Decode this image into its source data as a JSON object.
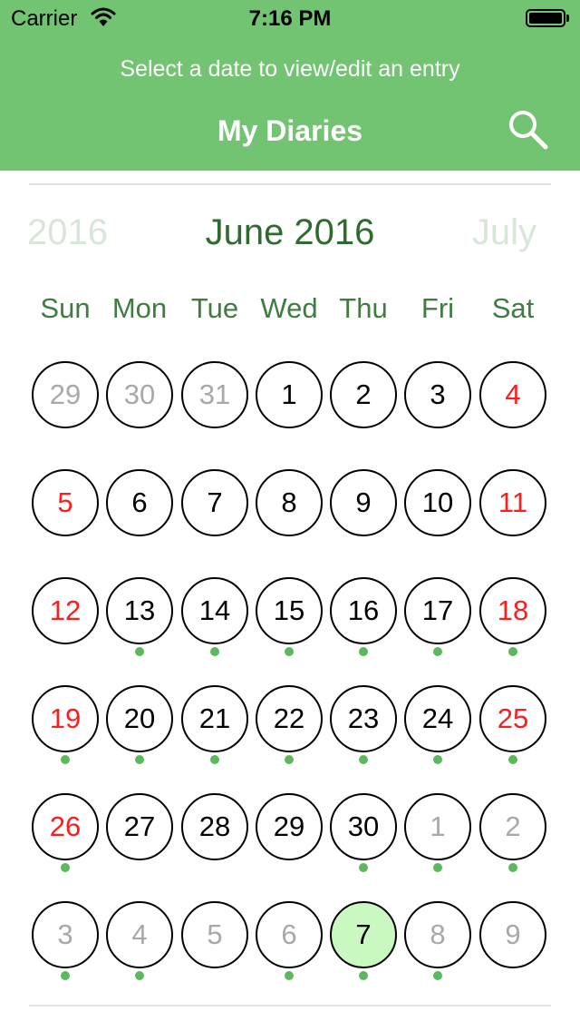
{
  "status_bar": {
    "carrier": "Carrier",
    "time": "7:16 PM"
  },
  "header": {
    "subtitle": "Select a date to view/edit an entry",
    "title": "My Diaries",
    "search_icon": "search-icon"
  },
  "calendar": {
    "prev_label": "2016",
    "month_title": "June 2016",
    "next_label": "July",
    "weekdays": [
      "Sun",
      "Mon",
      "Tue",
      "Wed",
      "Thu",
      "Fri",
      "Sat"
    ],
    "colors": {
      "accent": "#72c472",
      "weekend": "#ff1c1c",
      "outside_month": "#a8a8a8",
      "selected_fill": "#c9f9c0",
      "entry_dot": "#5cb85c"
    },
    "weeks": [
      [
        {
          "label": "29",
          "kind": "other",
          "dot": false
        },
        {
          "label": "30",
          "kind": "other",
          "dot": false
        },
        {
          "label": "31",
          "kind": "other",
          "dot": false
        },
        {
          "label": "1",
          "kind": "normal",
          "dot": false
        },
        {
          "label": "2",
          "kind": "normal",
          "dot": false
        },
        {
          "label": "3",
          "kind": "normal",
          "dot": false
        },
        {
          "label": "4",
          "kind": "weekend",
          "dot": false
        }
      ],
      [
        {
          "label": "5",
          "kind": "weekend",
          "dot": false
        },
        {
          "label": "6",
          "kind": "normal",
          "dot": false
        },
        {
          "label": "7",
          "kind": "normal",
          "dot": false
        },
        {
          "label": "8",
          "kind": "normal",
          "dot": false
        },
        {
          "label": "9",
          "kind": "normal",
          "dot": false
        },
        {
          "label": "10",
          "kind": "normal",
          "dot": false
        },
        {
          "label": "11",
          "kind": "weekend",
          "dot": false
        }
      ],
      [
        {
          "label": "12",
          "kind": "weekend",
          "dot": false
        },
        {
          "label": "13",
          "kind": "normal",
          "dot": true
        },
        {
          "label": "14",
          "kind": "normal",
          "dot": true
        },
        {
          "label": "15",
          "kind": "normal",
          "dot": true
        },
        {
          "label": "16",
          "kind": "normal",
          "dot": true
        },
        {
          "label": "17",
          "kind": "normal",
          "dot": true
        },
        {
          "label": "18",
          "kind": "weekend",
          "dot": true
        }
      ],
      [
        {
          "label": "19",
          "kind": "weekend",
          "dot": true
        },
        {
          "label": "20",
          "kind": "normal",
          "dot": true
        },
        {
          "label": "21",
          "kind": "normal",
          "dot": true
        },
        {
          "label": "22",
          "kind": "normal",
          "dot": true
        },
        {
          "label": "23",
          "kind": "normal",
          "dot": true
        },
        {
          "label": "24",
          "kind": "normal",
          "dot": true
        },
        {
          "label": "25",
          "kind": "weekend",
          "dot": true
        }
      ],
      [
        {
          "label": "26",
          "kind": "weekend",
          "dot": true
        },
        {
          "label": "27",
          "kind": "normal",
          "dot": false
        },
        {
          "label": "28",
          "kind": "normal",
          "dot": false
        },
        {
          "label": "29",
          "kind": "normal",
          "dot": false
        },
        {
          "label": "30",
          "kind": "normal",
          "dot": true
        },
        {
          "label": "1",
          "kind": "other",
          "dot": true
        },
        {
          "label": "2",
          "kind": "other",
          "dot": true
        }
      ],
      [
        {
          "label": "3",
          "kind": "other",
          "dot": true
        },
        {
          "label": "4",
          "kind": "other",
          "dot": true
        },
        {
          "label": "5",
          "kind": "other",
          "dot": false
        },
        {
          "label": "6",
          "kind": "other",
          "dot": true
        },
        {
          "label": "7",
          "kind": "selected",
          "dot": true
        },
        {
          "label": "8",
          "kind": "other",
          "dot": true
        },
        {
          "label": "9",
          "kind": "other",
          "dot": false
        }
      ]
    ]
  }
}
